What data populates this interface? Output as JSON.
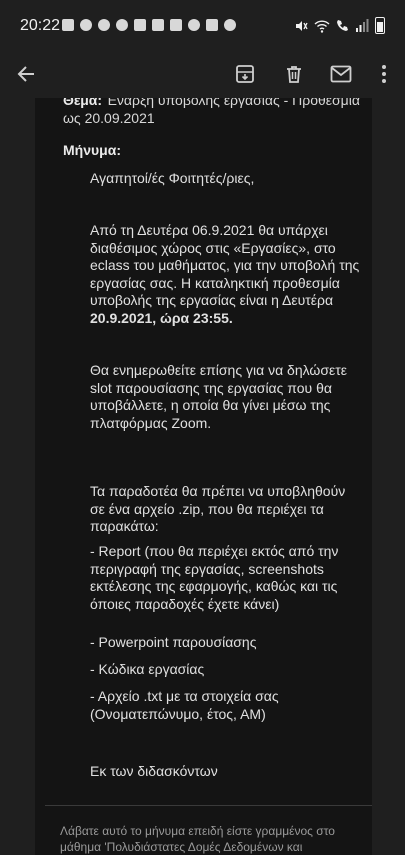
{
  "status": {
    "time": "20:22",
    "network": "LTE"
  },
  "toolbar": {
    "back_icon": "arrow-back-icon",
    "archive_icon": "archive-icon",
    "delete_icon": "trash-icon",
    "mail_icon": "mail-icon",
    "more_icon": "more-vert-icon"
  },
  "email": {
    "subject_label": "Θέμα:",
    "subject_text": "Έναρξη υποβολής εργασίας - Προθεσμία ως 20.09.2021",
    "message_label": "Μήνυμα:",
    "greeting": "Αγαπητοί/ές Φοιτητές/ριες,",
    "para1_a": "Από τη Δευτέρα 06.9.2021 θα υπάρχει διαθέσιμος χώρος στις «Εργασίες», στο eclass του μαθήματος, για την υποβολή της εργασίας σας. Η καταληκτική προθεσμία υποβολής της εργασίας είναι η Δευτέρα ",
    "para1_bold": "20.9.2021, ώρα 23:55.",
    "para2": "Θα ενημερωθείτε επίσης για να δηλώσετε slot  παρουσίασης της εργασίας που θα υποβάλλετε, η οποία θα γίνει μέσω της πλατφόρμας Zoom.",
    "para3": "Τα παραδοτέα θα πρέπει να υποβληθούν σε ένα αρχείο .zip, που θα περιέχει τα παρακάτω:",
    "item1": "- Report (που θα περιέχει εκτός από την περιγραφή της εργασίας, screenshots εκτέλεσης της εφαρμογής, καθώς και τις όποιες παραδοχές έχετε κάνει)",
    "item2": "- Powerpoint παρουσίασης",
    "item3": "- Κώδικα εργασίας",
    "item4": "- Αρχείο .txt με τα στοιχεία σας (Ονοματεπώνυμο, έτος, ΑΜ)",
    "signature": "Εκ των διδασκόντων",
    "footer": "Λάβατε αυτό το μήνυμα επειδή είστε γραμμένος στο μάθημα 'Πολυδιάστατες Δομές Δεδομένων και"
  },
  "colors": {
    "background": "#1f1f1f",
    "email_bg": "#141414",
    "text": "#e0e0e0",
    "footer_text": "#9a9a9a"
  }
}
